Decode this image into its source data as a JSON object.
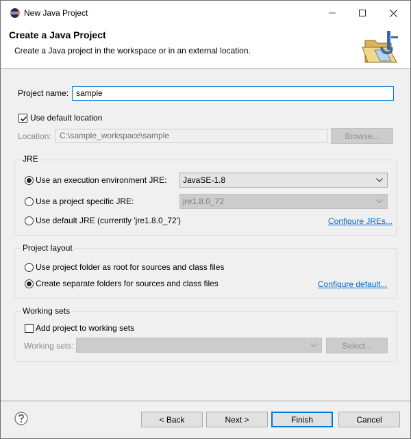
{
  "window": {
    "title": "New Java Project",
    "buttons": [
      "minimize",
      "maximize",
      "close"
    ]
  },
  "banner": {
    "title": "Create a Java Project",
    "description": "Create a Java project in the workspace or in an external location."
  },
  "project": {
    "name_label": "Project name:",
    "name_value": "sample",
    "use_default_location_label": "Use default location",
    "use_default_location_checked": true,
    "location_label": "Location:",
    "location_value": "C:\\sample_workspace\\sample",
    "browse_label": "Browse..."
  },
  "jre": {
    "group_title": "JRE",
    "options": [
      {
        "label": "Use an execution environment JRE:",
        "selected": true
      },
      {
        "label": "Use a project specific JRE:",
        "selected": false
      },
      {
        "label": "Use default JRE (currently 'jre1.8.0_72')",
        "selected": false
      }
    ],
    "execution_env_value": "JavaSE-1.8",
    "project_specific_value": "jre1.8.0_72",
    "configure_link": "Configure JREs..."
  },
  "layout": {
    "group_title": "Project layout",
    "options": [
      {
        "label": "Use project folder as root for sources and class files",
        "selected": false
      },
      {
        "label": "Create separate folders for sources and class files",
        "selected": true
      }
    ],
    "configure_link": "Configure default..."
  },
  "working_sets": {
    "group_title": "Working sets",
    "add_label": "Add project to working sets",
    "add_checked": false,
    "sets_label": "Working sets:",
    "sets_value": "",
    "select_label": "Select..."
  },
  "footer": {
    "back_label": "< Back",
    "next_label": "Next >",
    "finish_label": "Finish",
    "cancel_label": "Cancel"
  },
  "colors": {
    "accent": "#0078d7",
    "link": "#0066cc",
    "dialog_bg": "#f0f0f0"
  },
  "icons": [
    "eclipse-icon",
    "minimize-icon",
    "maximize-icon",
    "close-icon",
    "java-folder-icon",
    "chevron-down-icon",
    "help-icon"
  ]
}
